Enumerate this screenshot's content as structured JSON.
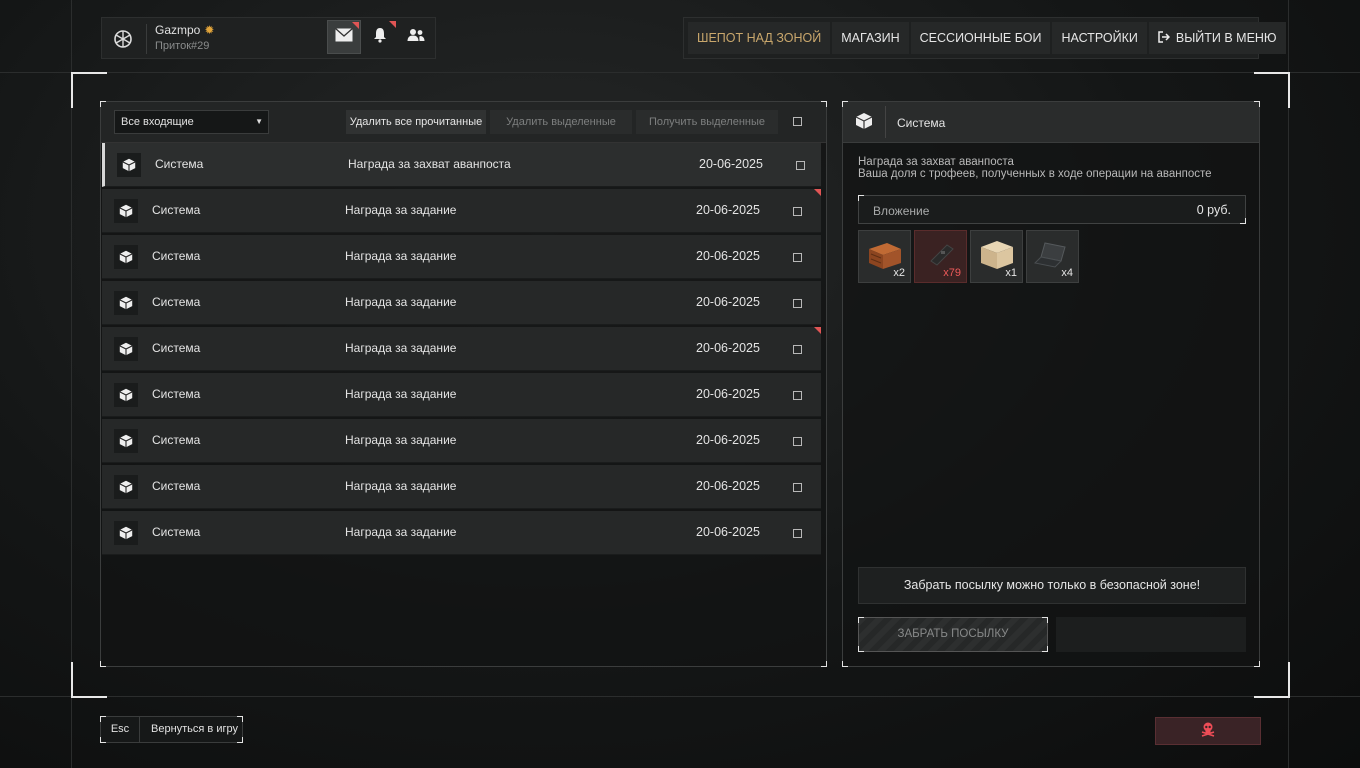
{
  "profile": {
    "name": "Gazmpo",
    "rank": "Приток#29",
    "badge_glyph": "✹",
    "icons": [
      "emblem-icon",
      "mail-icon",
      "bell-icon",
      "friends-icon"
    ]
  },
  "nav": {
    "items": [
      "ШЕПОТ НАД ЗОНОЙ",
      "МАГАЗИН",
      "СЕССИОННЫЕ БОИ",
      "НАСТРОЙКИ",
      "ВЫЙТИ В МЕНЮ"
    ],
    "accent_color": "#c9a76c"
  },
  "mail": {
    "filter": "Все входящие",
    "delete_read": "Удалить все прочитанные",
    "delete_selected": "Удалить выделенные",
    "receive_selected": "Получить выделенные",
    "rows": [
      {
        "sender": "Система",
        "subject": "Награда за захват аванпоста",
        "date": "20-06-2025"
      },
      {
        "sender": "Система",
        "subject": "Награда за задание",
        "date": "20-06-2025"
      },
      {
        "sender": "Система",
        "subject": "Награда за задание",
        "date": "20-06-2025"
      },
      {
        "sender": "Система",
        "subject": "Награда за задание",
        "date": "20-06-2025"
      },
      {
        "sender": "Система",
        "subject": "Награда за задание",
        "date": "20-06-2025"
      },
      {
        "sender": "Система",
        "subject": "Награда за задание",
        "date": "20-06-2025"
      },
      {
        "sender": "Система",
        "subject": "Награда за задание",
        "date": "20-06-2025"
      },
      {
        "sender": "Система",
        "subject": "Награда за задание",
        "date": "20-06-2025"
      },
      {
        "sender": "Система",
        "subject": "Награда за задание",
        "date": "20-06-2025"
      }
    ]
  },
  "detail": {
    "sender": "Система",
    "line1": "Награда за захват аванпоста",
    "line2": "Ваша доля с трофеев, полученных в ходе операции на аванпосте",
    "attachment_label": "Вложение",
    "attachment_value": "0 руб.",
    "items": [
      {
        "name": "wooden-crate-icon",
        "qty": "x2"
      },
      {
        "name": "magazine-icon",
        "qty": "x79",
        "warning_color": "#ee5a5a"
      },
      {
        "name": "cardboard-box-icon",
        "qty": "x1"
      },
      {
        "name": "laptop-icon",
        "qty": "x4"
      }
    ],
    "notice": "Забрать посылку можно только в безопасной зоне!",
    "claim": "ЗАБРАТЬ ПОСЫЛКУ"
  },
  "footer": {
    "key": "Esc",
    "back": "Вернуться в игру",
    "danger_color": "#ef4d57"
  }
}
